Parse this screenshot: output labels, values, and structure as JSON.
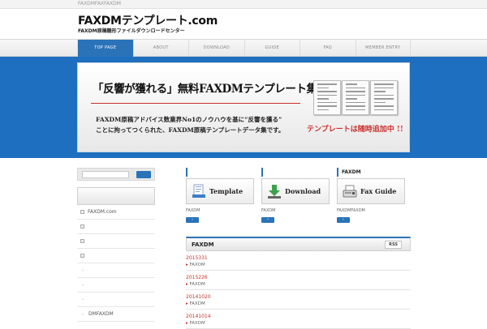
{
  "topbar": {
    "text": "FAXDMFAXFAXDM"
  },
  "header": {
    "logo": "FAXDMテンプレート.com",
    "tagline": "FAXDM原稿雛形ファイルダウンロードセンター"
  },
  "nav": {
    "items": [
      {
        "label": "TOP PAGE",
        "active": true
      },
      {
        "label": "ABOUT"
      },
      {
        "label": "DOWNLOAD"
      },
      {
        "label": "GUIDE"
      },
      {
        "label": "FAQ"
      },
      {
        "label": "MEMBER ENTRY"
      }
    ]
  },
  "hero": {
    "headline": "「反響が獲れる」無料FAXDMテンプレート集",
    "line1": "FAXDM原稿アドバイス数業界No1のノウハウを基に“反響を獲る”",
    "line2": "ことに拘ってつくられた、FAXDM原稿テンプレートデータ集です。",
    "adding": "テンプレートは随時追加中 !!"
  },
  "sidebar": {
    "items": [
      {
        "label": "FAXDM.com",
        "kind": "box"
      },
      {
        "label": "",
        "kind": "box"
      },
      {
        "label": "",
        "kind": "box"
      },
      {
        "label": "",
        "kind": "box"
      },
      {
        "label": "",
        "kind": "chev"
      },
      {
        "label": "",
        "kind": "chev"
      },
      {
        "label": "",
        "kind": "chev"
      },
      {
        "label": "DMFAXDM",
        "kind": "chev"
      }
    ]
  },
  "cards": [
    {
      "title": "",
      "banner": "Template",
      "caption": "FAXDM"
    },
    {
      "title": "",
      "banner": "Download",
      "caption": "FAXDM"
    },
    {
      "title": "FAXDM",
      "banner": "Fax Guide",
      "caption": "FAXDMFAXDM"
    }
  ],
  "news": {
    "title": "FAXDM",
    "rss": "RSS",
    "entries": [
      {
        "date": "2015331",
        "category": "FAXDM"
      },
      {
        "date": "2015226",
        "category": "FAXDM"
      },
      {
        "date": "20141020",
        "category": "FAXDM"
      },
      {
        "date": "20141014",
        "category": "FAXDM"
      }
    ]
  },
  "colors": {
    "brand_blue": "#2a73b8",
    "band_blue": "#1e6fbf",
    "accent_red": "#c9302c"
  }
}
